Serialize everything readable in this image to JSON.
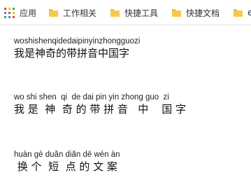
{
  "bookmarks": [
    {
      "label": "应用",
      "icon": "apps-grid-icon"
    },
    {
      "label": "工作相关",
      "icon": "folder-icon"
    },
    {
      "label": "快捷工具",
      "icon": "folder-icon"
    },
    {
      "label": "快捷文档",
      "icon": "folder-icon"
    },
    {
      "label": "e",
      "icon": "folder-icon"
    }
  ],
  "apps_colors": [
    "#ea4335",
    "#fbbc05",
    "#34a853",
    "#4285f4",
    "#ea4335",
    "#fbbc05",
    "#34a853",
    "#4285f4",
    "#ea4335"
  ],
  "folder_color": "#f5c94d",
  "examples": [
    {
      "pinyin": "woshishenqidedaipinyinzhongguozi",
      "hanzi": "我是神奇的带拼音中国字"
    },
    {
      "pinyin": "wo shi shen  qi  de dai pin yin zhong guo  zi",
      "hanzi": "我 是  神  奇 的 带 拼 音   中    国 字"
    },
    {
      "pinyin": "huàn gè duǎn diǎn dē wén àn",
      "hanzi": " 换 个  短  点 的 文 案"
    }
  ]
}
